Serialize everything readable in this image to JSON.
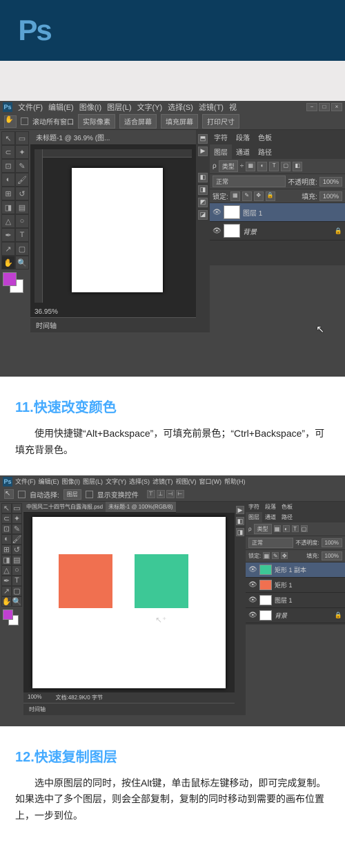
{
  "logo": "Ps",
  "app1": {
    "menu": [
      "文件(F)",
      "编辑(E)",
      "图像(I)",
      "图层(L)",
      "文字(Y)",
      "选择(S)",
      "滤镜(T)",
      "视"
    ],
    "opt_scroll": "滚动所有窗口",
    "opt_btns": [
      "实际像素",
      "适合屏幕",
      "填充屏幕",
      "打印尺寸"
    ],
    "doc_tab": "未标题-1 @ 36.9% (图...",
    "zoom": "36.95%",
    "timeline": "时间轴",
    "panel_tabs_top": [
      "字符",
      "段落",
      "色板"
    ],
    "panel_tabs_mid": [
      "图层",
      "通道",
      "路径"
    ],
    "kind_dd": "类型",
    "blend": "正常",
    "opacity_lbl": "不透明度:",
    "opacity_val": "100%",
    "lock_lbl": "锁定:",
    "fill_lbl": "填充:",
    "fill_val": "100%",
    "layers": [
      {
        "name": "图层 1",
        "sel": true,
        "thumb": "white"
      },
      {
        "name": "背景",
        "sel": false,
        "thumb": "white",
        "locked": true
      }
    ]
  },
  "section11": {
    "title": "11.快速改变颜色",
    "body": "使用快捷键“Alt+Backspace”，可填充前景色；“Ctrl+Backspace”，可填充背景色。"
  },
  "app2": {
    "menu": [
      "文件(F)",
      "编辑(E)",
      "图像(I)",
      "图层(L)",
      "文字(Y)",
      "选择(S)",
      "滤镜(T)",
      "视图(V)",
      "窗口(W)",
      "帮助(H)"
    ],
    "autosel": "自动选择:",
    "autosel_dd": "图层",
    "showtrans": "显示变换控件",
    "doc_tab1": "中国风二十四节气白露海报.psd",
    "doc_tab2": "未标题-1 @ 100%(RGB/8)",
    "zoom": "100%",
    "docinfo": "文档:482.9K/0 字节",
    "timeline": "时间轴",
    "panel_tabs_top": [
      "字符",
      "段落",
      "色板"
    ],
    "panel_tabs_mid": [
      "图层",
      "通道",
      "路径"
    ],
    "kind_dd": "类型",
    "blend": "正常",
    "opacity_lbl": "不透明度:",
    "opacity_val": "100%",
    "lock_lbl": "锁定:",
    "fill_lbl": "填充:",
    "fill_val": "100%",
    "layers": [
      {
        "name": "矩形 1 副本",
        "sel": true,
        "thumb": "green"
      },
      {
        "name": "矩形 1",
        "sel": false,
        "thumb": "orange"
      },
      {
        "name": "图层 1",
        "sel": false,
        "thumb": "white"
      },
      {
        "name": "背景",
        "sel": false,
        "thumb": "white",
        "locked": true
      }
    ]
  },
  "section12": {
    "title": "12.快速复制图层",
    "body": "选中原图层的同时，按住Alt键，单击鼠标左键移动，即可完成复制。如果选中了多个图层，则会全部复制，复制的同时移动到需要的画布位置上，一步到位。"
  }
}
